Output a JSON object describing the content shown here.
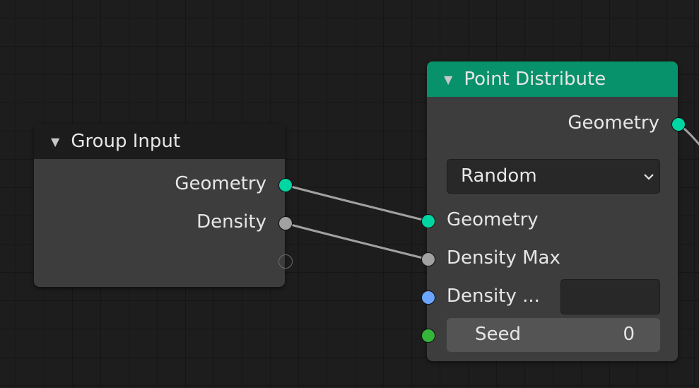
{
  "colors": {
    "geometry_socket": "#00d6a3",
    "float_socket": "#a1a1a1",
    "vector_socket": "#6aa5ff",
    "int_socket": "#35b53a",
    "point_header": "#07926b",
    "group_header": "#1c1c1c",
    "link": "#a1a1a1"
  },
  "group_input": {
    "title": "Group Input",
    "collapse_icon": "triangle-down",
    "outputs": [
      "Geometry",
      "Density"
    ]
  },
  "point_distribute": {
    "title": "Point Distribute",
    "collapse_icon": "triangle-down",
    "output_geometry": "Geometry",
    "mode": {
      "value": "Random",
      "icon": "chevron-down"
    },
    "inputs": {
      "geometry": "Geometry",
      "density_max": "Density Max",
      "density_attribute": "Density ...",
      "seed_label": "Seed",
      "seed_value": "0"
    }
  }
}
